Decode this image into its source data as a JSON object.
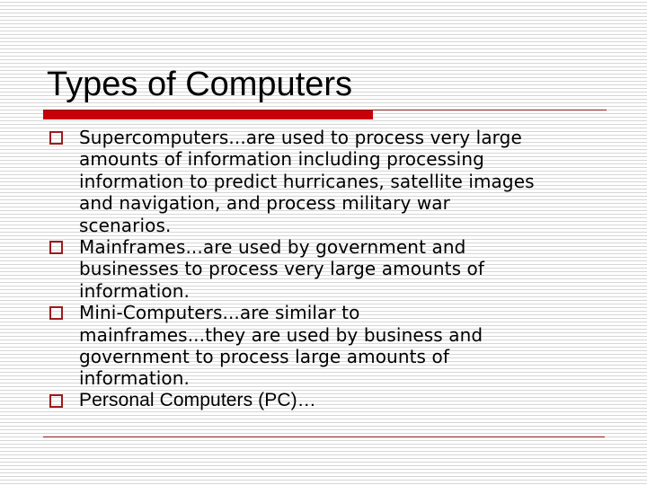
{
  "slide": {
    "title": "Types of Computers",
    "accent_color": "#c8000a",
    "bullets": [
      {
        "lines": [
          "Supercomputers...are used to process very large",
          "amounts of information including processing",
          "information to predict hurricanes, satellite images",
          "and navigation, and process military war",
          "scenarios."
        ]
      },
      {
        "lines": [
          "Mainframes...are used by government and",
          "businesses to process very large amounts of",
          "information."
        ]
      },
      {
        "lines": [
          "Mini-Computers...are similar to",
          "mainframes...they are used by business and",
          "government to process large amounts of",
          "information."
        ]
      },
      {
        "lines": [
          "Personal Computers (PC)…"
        ]
      }
    ]
  }
}
